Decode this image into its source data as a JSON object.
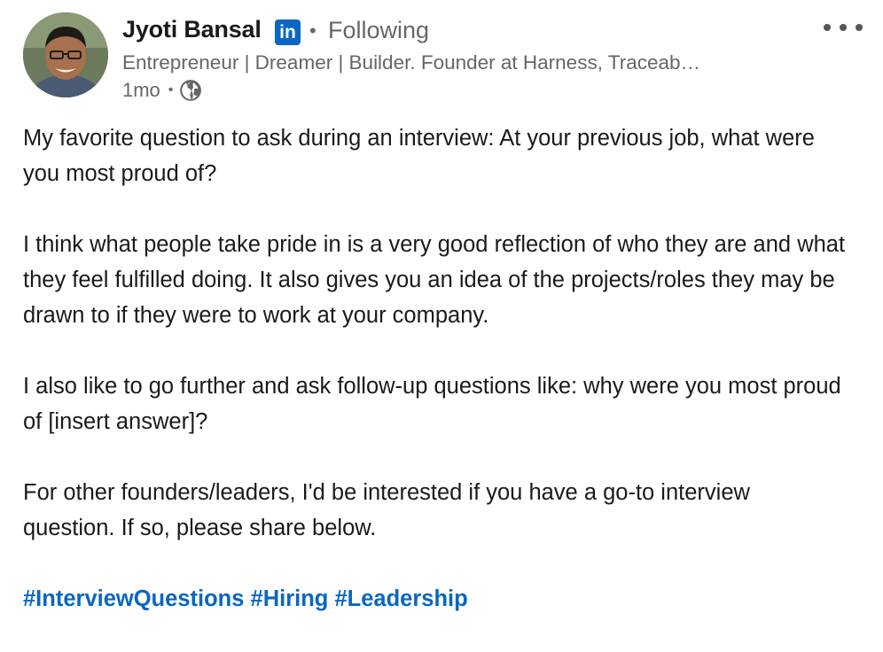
{
  "author": {
    "name": "Jyoti Bansal",
    "network_badge": "in",
    "separator": "•",
    "follow_status": "Following",
    "headline": "Entrepreneur | Dreamer | Builder. Founder at Harness, Traceab…",
    "time_ago": "1mo",
    "meta_separator": "•"
  },
  "post": {
    "paragraphs": [
      "My favorite question to ask during an interview: At your previous job, what were you most proud of?",
      "I think what people take pride in is a very good reflection of who they are and what they feel fulfilled doing. It also gives you an idea of the projects/roles they may be drawn to if they were to work at your company.",
      "I also like to go further and ask follow-up questions like: why were you most proud of [insert answer]?",
      "For other founders/leaders, I'd be interested if you have a go-to interview question. If so, please share below."
    ],
    "hashtags": [
      "#InterviewQuestions",
      "#Hiring",
      "#Leadership"
    ]
  },
  "icons": {
    "avatar": "profile-photo",
    "badge": "linkedin-icon",
    "visibility": "globe-icon",
    "menu": "more-options-icon"
  },
  "colors": {
    "accent": "#0a66c2",
    "muted_text": "#666666",
    "body_text": "#1a1a1a"
  }
}
